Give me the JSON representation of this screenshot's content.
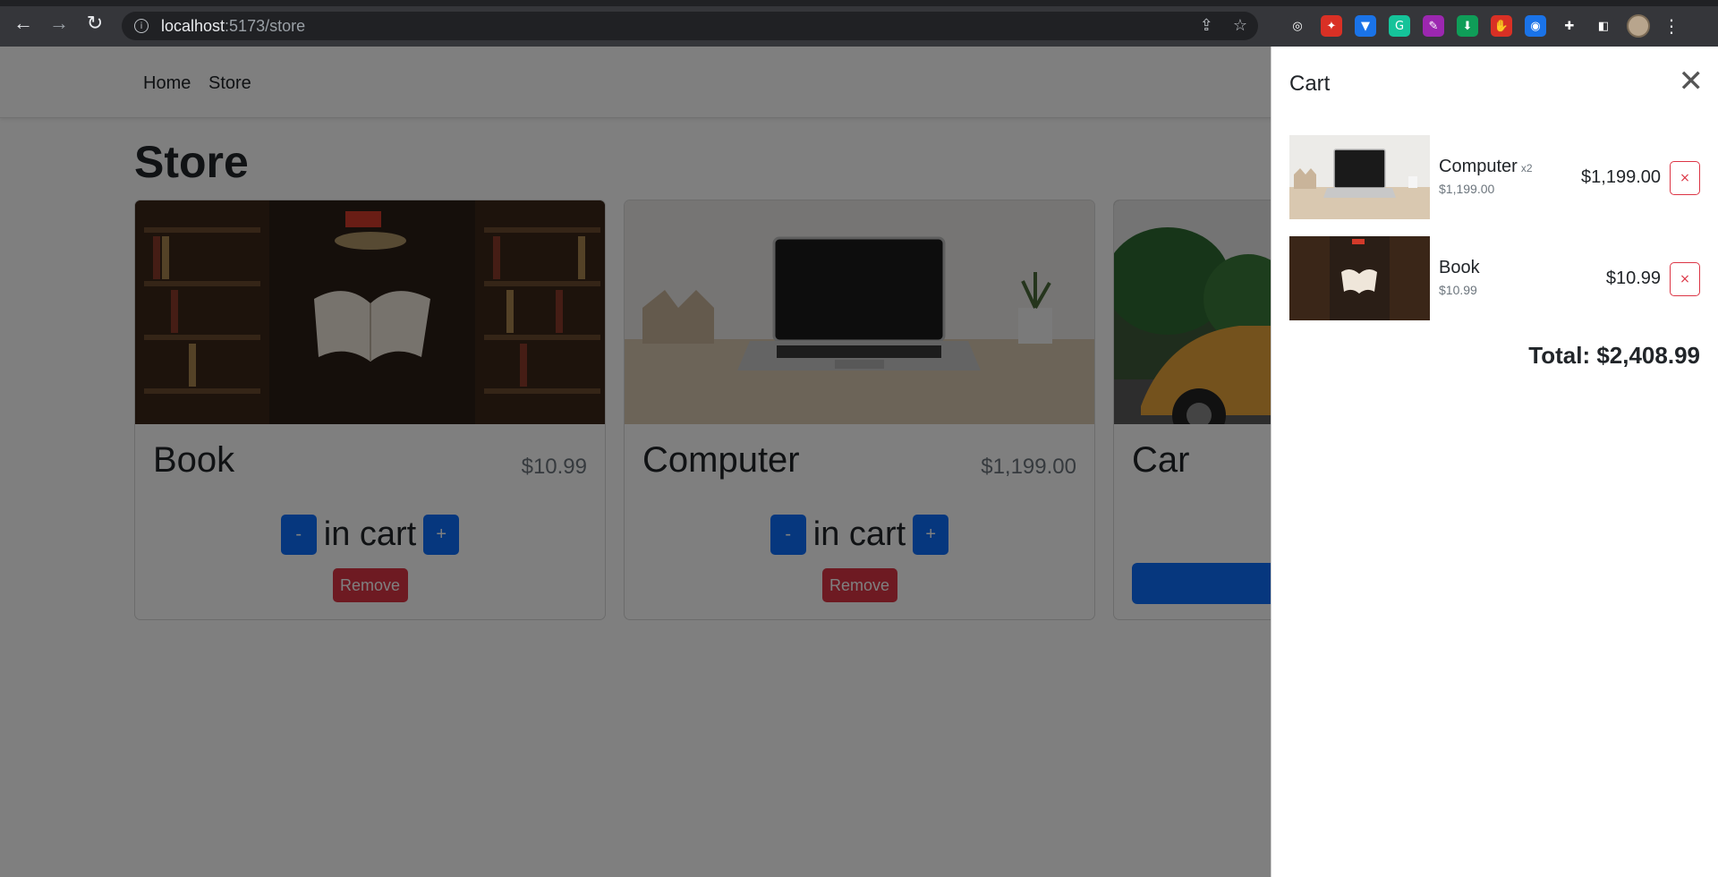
{
  "browser": {
    "url_host": "localhost",
    "url_path": ":5173/store",
    "icons": [
      "back-arrow-icon",
      "forward-arrow-icon",
      "reload-icon",
      "site-info-icon",
      "share-icon",
      "bookmark-star-icon"
    ],
    "extensions": [
      {
        "name": "target-extension-icon",
        "color": "#35363a",
        "glyph": "◎"
      },
      {
        "name": "red-game-extension-icon",
        "color": "#d93025",
        "glyph": "✦"
      },
      {
        "name": "vpn-shield-extension-icon",
        "color": "#1a73e8",
        "glyph": "▼"
      },
      {
        "name": "grammarly-extension-icon",
        "color": "#15c39a",
        "glyph": "G"
      },
      {
        "name": "purple-pipette-extension-icon",
        "color": "#9c27b0",
        "glyph": "✎"
      },
      {
        "name": "green-download-extension-icon",
        "color": "#0f9d58",
        "glyph": "⬇"
      },
      {
        "name": "red-stop-hand-extension-icon",
        "color": "#d93025",
        "glyph": "✋"
      },
      {
        "name": "screen-capture-extension-icon",
        "color": "#1a73e8",
        "glyph": "◉"
      },
      {
        "name": "puzzle-extensions-icon",
        "color": "#35363a",
        "glyph": "✚"
      },
      {
        "name": "side-panel-icon",
        "color": "#35363a",
        "glyph": "◧"
      }
    ]
  },
  "navbar": {
    "home_label": "Home",
    "store_label": "Store"
  },
  "store": {
    "title": "Store",
    "items": [
      {
        "name": "Book",
        "price": "$10.99",
        "minus": "-",
        "qty_text": "in cart",
        "plus": "+",
        "remove": "Remove"
      },
      {
        "name": "Computer",
        "price": "$1,199.00",
        "minus": "-",
        "qty_text": "in cart",
        "plus": "+",
        "remove": "Remove"
      },
      {
        "name": "Car"
      }
    ]
  },
  "cart": {
    "title": "Cart",
    "close_glyph": "✕",
    "items": [
      {
        "name": "Computer",
        "qty": "x2",
        "unit_price": "$1,199.00",
        "total": "$1,199.00",
        "remove_glyph": "×"
      },
      {
        "name": "Book",
        "qty": "",
        "unit_price": "$10.99",
        "total": "$10.99",
        "remove_glyph": "×"
      }
    ],
    "total_label": "Total: $2,408.99"
  }
}
